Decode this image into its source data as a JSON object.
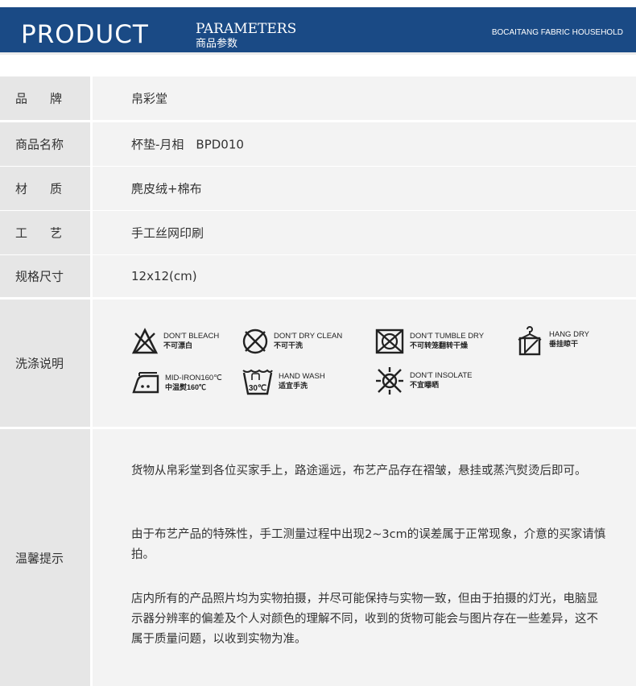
{
  "header": {
    "product": "PRODUCT",
    "parameters": "PARAMETERS",
    "parameters_cn": "商品参数",
    "shop": "BOCAITANG FABRIC HOUSEHOLD"
  },
  "rows": [
    {
      "label": "品牌",
      "value": "帛彩堂"
    },
    {
      "label": "商品名称",
      "value": "杯垫-月相　BPD010"
    },
    {
      "label": "材质",
      "value": "麂皮绒+棉布"
    },
    {
      "label": "工艺",
      "value": "手工丝网印刷"
    },
    {
      "label": "规格尺寸",
      "value": "12x12(cm)"
    }
  ],
  "wash": {
    "label": "洗涤说明",
    "symbols": [
      {
        "icon": "no-bleach-icon",
        "en": "DON'T BLEACH",
        "cn": "不可漂白"
      },
      {
        "icon": "no-dry-clean-icon",
        "en": "DON'T DRY CLEAN",
        "cn": "不可干洗"
      },
      {
        "icon": "no-tumble-dry-icon",
        "en": "DON'T TUMBLE DRY",
        "cn": "不可转笼翻转干燥"
      },
      {
        "icon": "hang-dry-icon",
        "en": "HANG DRY",
        "cn": "垂挂晾干"
      },
      {
        "icon": "mid-iron-icon",
        "en": "MID-IRON160℃",
        "cn": "中温熨160℃"
      },
      {
        "icon": "hand-wash-icon",
        "en": "HAND WASH",
        "cn": "适宜手洗",
        "tub_label": "30℃"
      },
      {
        "icon": "no-insolate-icon",
        "en": "DON'T INSOLATE",
        "cn": "不宜曝晒"
      }
    ]
  },
  "notes": {
    "label": "温馨提示",
    "paragraphs": [
      "货物从帛彩堂到各位买家手上，路途遥远，布艺产品存在褶皱，悬挂或蒸汽熨烫后即可。",
      "由于布艺产品的特殊性，手工测量过程中出现2~3cm的误差属于正常现象，介意的买家请慎拍。",
      "店内所有的产品照片均为实物拍摄，并尽可能保持与实物一致，但由于拍摄的灯光，电脑显示器分辨率的偏差及个人对颜色的理解不同，收到的货物可能会与图片存在一些差异，这不属于质量问题，以收到实物为准。"
    ]
  }
}
